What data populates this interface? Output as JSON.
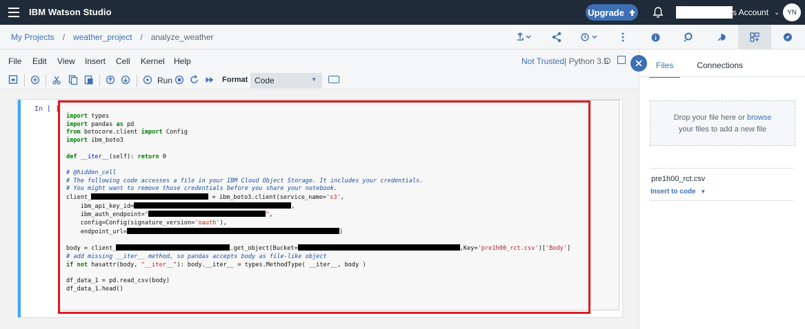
{
  "app": {
    "brand": "IBM Watson Studio",
    "upgrade_label": "Upgrade",
    "account_label": "s Account",
    "avatar_initials": "YN"
  },
  "breadcrumb": {
    "items": [
      "My Projects",
      "weather_project"
    ],
    "current": "analyze_weather",
    "separator": "/"
  },
  "menu": {
    "items": [
      "File",
      "Edit",
      "View",
      "Insert",
      "Cell",
      "Kernel",
      "Help"
    ],
    "trust_status": "Not Trusted",
    "kernel": "| Python 3.5"
  },
  "toolbar": {
    "run_label": "Run",
    "format_label": "Format",
    "cell_type": "Code"
  },
  "cell": {
    "prompt": "In [ ]:"
  },
  "right_panel": {
    "tabs": [
      "Files",
      "Connections"
    ],
    "dropzone_line1": "Drop your file here or ",
    "dropzone_link": "browse",
    "dropzone_line2": "your files to add a new file",
    "file_name": "pre1h00_rct.csv",
    "insert_label": "Insert to code"
  },
  "colors": {
    "topbar": "#1f2b38",
    "accent": "#3d70b2",
    "highlight": "#e0191f"
  }
}
